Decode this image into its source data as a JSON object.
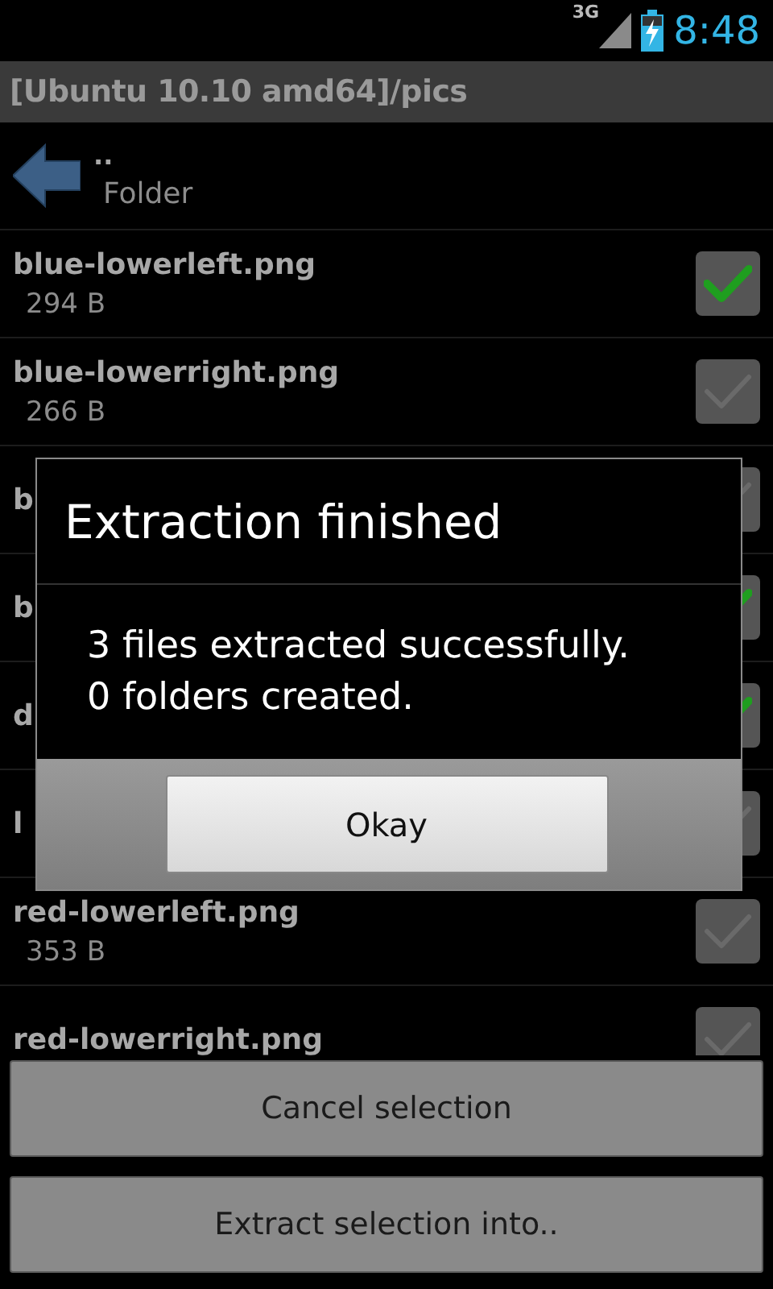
{
  "status_bar": {
    "network": "3G",
    "time": "8:48"
  },
  "title": "[Ubuntu 10.10 amd64]/pics",
  "parent_entry": {
    "name": "..",
    "type": "Folder"
  },
  "files": [
    {
      "name": "blue-lowerleft.png",
      "size": "294 B",
      "checked": true
    },
    {
      "name": "blue-lowerright.png",
      "size": "266 B",
      "checked": false
    },
    {
      "name": "b",
      "checked": false
    },
    {
      "name": "b",
      "checked": true
    },
    {
      "name": "d",
      "checked": true
    },
    {
      "name": "l",
      "checked": false
    },
    {
      "name": "red-lowerleft.png",
      "size": "353 B",
      "checked": false
    },
    {
      "name": "red-lowerright.png",
      "checked": false
    }
  ],
  "dialog": {
    "title": "Extraction finished",
    "message": "3 files extracted successfully.\n0 folders created.",
    "button": "Okay"
  },
  "buttons": [
    "Cancel selection",
    "Extract selection into.."
  ]
}
